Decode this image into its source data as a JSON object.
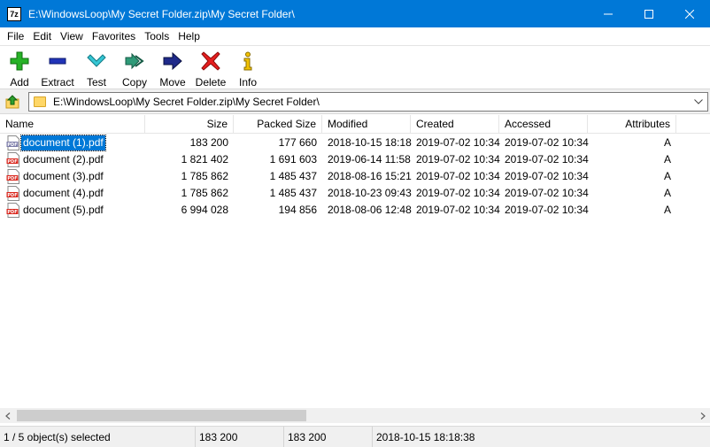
{
  "window": {
    "app_icon_text": "7z",
    "title": "E:\\WindowsLoop\\My Secret Folder.zip\\My Secret Folder\\"
  },
  "menu": [
    "File",
    "Edit",
    "View",
    "Favorites",
    "Tools",
    "Help"
  ],
  "toolbar": [
    {
      "label": "Add",
      "icon": "plus-icon",
      "color": "#1aa11a"
    },
    {
      "label": "Extract",
      "icon": "minus-icon",
      "color": "#1c2fb0"
    },
    {
      "label": "Test",
      "icon": "check-icon",
      "color": "#2bbcc9"
    },
    {
      "label": "Copy",
      "icon": "double-arrow-icon",
      "color": "#2a8a6a"
    },
    {
      "label": "Move",
      "icon": "arrow-right-icon",
      "color": "#1a237e"
    },
    {
      "label": "Delete",
      "icon": "x-icon",
      "color": "#e01b1b"
    },
    {
      "label": "Info",
      "icon": "info-icon",
      "color": "#d4a800"
    }
  ],
  "address": {
    "path": "E:\\WindowsLoop\\My Secret Folder.zip\\My Secret Folder\\"
  },
  "columns": [
    "Name",
    "Size",
    "Packed Size",
    "Modified",
    "Created",
    "Accessed",
    "Attributes"
  ],
  "files": [
    {
      "name": "document (1).pdf",
      "size": "183 200",
      "packed": "177 660",
      "modified": "2018-10-15 18:18",
      "created": "2019-07-02 10:34",
      "accessed": "2019-07-02 10:34",
      "attr": "A",
      "selected": true
    },
    {
      "name": "document (2).pdf",
      "size": "1 821 402",
      "packed": "1 691 603",
      "modified": "2019-06-14 11:58",
      "created": "2019-07-02 10:34",
      "accessed": "2019-07-02 10:34",
      "attr": "A",
      "selected": false
    },
    {
      "name": "document (3).pdf",
      "size": "1 785 862",
      "packed": "1 485 437",
      "modified": "2018-08-16 15:21",
      "created": "2019-07-02 10:34",
      "accessed": "2019-07-02 10:34",
      "attr": "A",
      "selected": false
    },
    {
      "name": "document (4).pdf",
      "size": "1 785 862",
      "packed": "1 485 437",
      "modified": "2018-10-23 09:43",
      "created": "2019-07-02 10:34",
      "accessed": "2019-07-02 10:34",
      "attr": "A",
      "selected": false
    },
    {
      "name": "document (5).pdf",
      "size": "6 994 028",
      "packed": "194 856",
      "modified": "2018-08-06 12:48",
      "created": "2019-07-02 10:34",
      "accessed": "2019-07-02 10:34",
      "attr": "A",
      "selected": false
    }
  ],
  "status": {
    "selection": "1 / 5 object(s) selected",
    "size": "183 200",
    "packed": "183 200",
    "modified": "2018-10-15 18:18:38"
  },
  "colors": {
    "titlebar": "#0078d7",
    "selection": "#0078d7",
    "pdf_red": "#d9261c"
  }
}
